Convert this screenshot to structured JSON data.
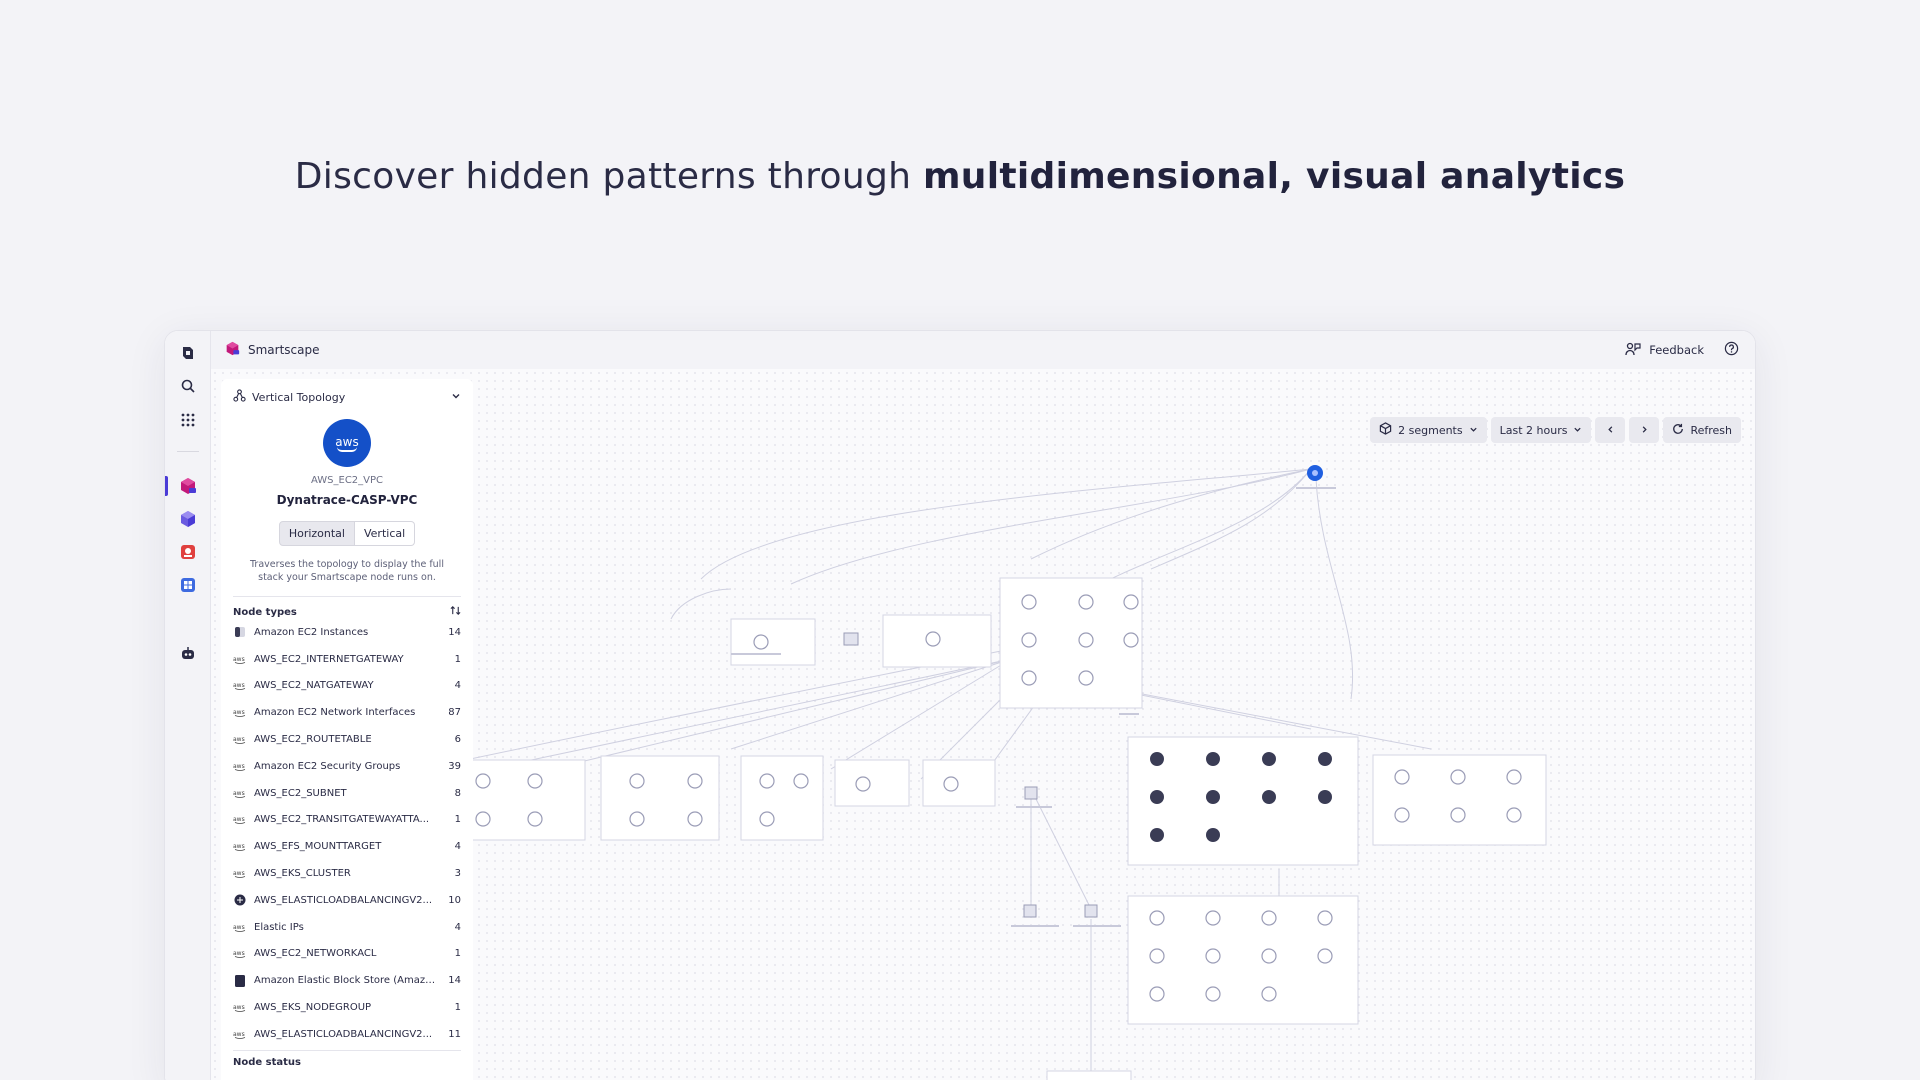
{
  "headline": {
    "lead": "Discover hidden patterns through ",
    "bold": "multidimensional, visual analytics"
  },
  "app": {
    "title": "Smartscape"
  },
  "top": {
    "feedback_label": "Feedback"
  },
  "panel": {
    "view_label": "Vertical Topology",
    "logo_text": "aws",
    "entity_type": "AWS_EC2_VPC",
    "entity_name": "Dynatrace-CASP-VPC",
    "orientation": {
      "horizontal": "Horizontal",
      "vertical": "Vertical"
    },
    "description": "Traverses the topology to display the full stack your Smartscape node runs on.",
    "node_types_label": "Node types",
    "node_status_label": "Node status",
    "node_types": [
      {
        "icon": "ec2-instance-icon",
        "name": "Amazon EC2 Instances",
        "count": "14"
      },
      {
        "icon": "aws-icon",
        "name": "AWS_EC2_INTERNETGATEWAY",
        "count": "1"
      },
      {
        "icon": "aws-icon",
        "name": "AWS_EC2_NATGATEWAY",
        "count": "4"
      },
      {
        "icon": "aws-icon",
        "name": "Amazon EC2 Network Interfaces",
        "count": "87"
      },
      {
        "icon": "aws-icon",
        "name": "AWS_EC2_ROUTETABLE",
        "count": "6"
      },
      {
        "icon": "aws-icon",
        "name": "Amazon EC2 Security Groups",
        "count": "39"
      },
      {
        "icon": "aws-icon",
        "name": "AWS_EC2_SUBNET",
        "count": "8"
      },
      {
        "icon": "aws-icon",
        "name": "AWS_EC2_TRANSITGATEWAYATTA...",
        "count": "1"
      },
      {
        "icon": "aws-icon",
        "name": "AWS_EFS_MOUNTTARGET",
        "count": "4"
      },
      {
        "icon": "aws-icon",
        "name": "AWS_EKS_CLUSTER",
        "count": "3"
      },
      {
        "icon": "load-balancer-icon",
        "name": "AWS_ELASTICLOADBALANCINGV2...",
        "count": "10"
      },
      {
        "icon": "aws-icon",
        "name": "Elastic IPs",
        "count": "4"
      },
      {
        "icon": "aws-icon",
        "name": "AWS_EC2_NETWORKACL",
        "count": "1"
      },
      {
        "icon": "block-store-icon",
        "name": "Amazon Elastic Block Store (Amazo...",
        "count": "14"
      },
      {
        "icon": "aws-icon",
        "name": "AWS_EKS_NODEGROUP",
        "count": "1"
      },
      {
        "icon": "aws-icon",
        "name": "AWS_ELASTICLOADBALANCINGV2...",
        "count": "11"
      }
    ]
  },
  "toolbar": {
    "segments_label": "2 segments",
    "timeframe_label": "Last 2 hours",
    "refresh_label": "Refresh"
  },
  "colors": {
    "accent": "#4a3bd6",
    "aws_blue": "#1450c8",
    "canvas": "#fafafc"
  }
}
